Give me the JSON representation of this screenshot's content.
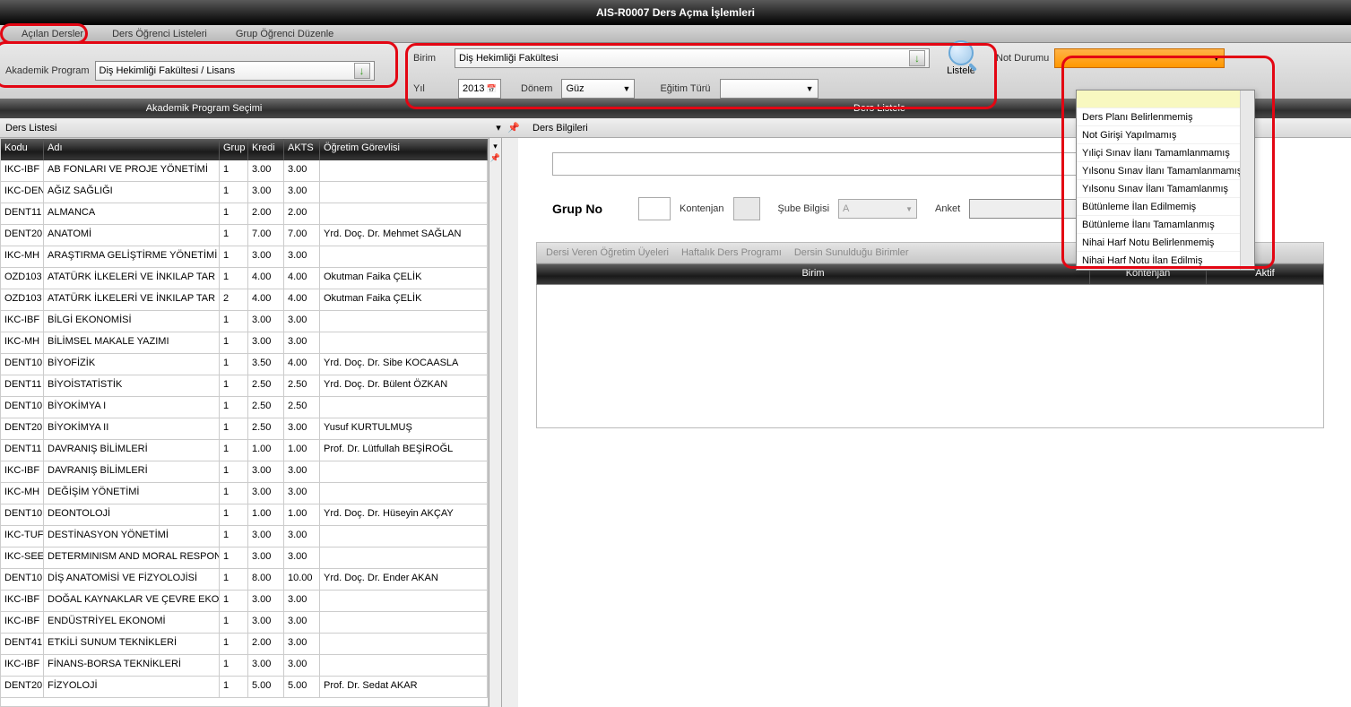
{
  "window": {
    "title": "AIS-R0007 Ders Açma İşlemleri"
  },
  "menubar": {
    "items": [
      {
        "label": "Açılan Dersler"
      },
      {
        "label": "Ders Öğrenci Listeleri"
      },
      {
        "label": "Grup Öğrenci Düzenle"
      }
    ]
  },
  "filters": {
    "akademik_program_label": "Akademik Program",
    "akademik_program_value": "Diş Hekimliği Fakültesi / Lisans",
    "birim_label": "Birim",
    "birim_value": "Diş Hekimliği Fakültesi",
    "yil_label": "Yıl",
    "yil_value": "2013",
    "donem_label": "Dönem",
    "donem_value": "Güz",
    "egitim_turu_label": "Eğitim Türü",
    "egitim_turu_value": "",
    "listele_label": "Listele",
    "not_durumu_label": "Not Durumu"
  },
  "section_headers": {
    "left": "Akademik Program Seçimi",
    "right": "Ders Listele"
  },
  "sub_headers": {
    "left": "Ders Listesi",
    "right": "Ders Bilgileri"
  },
  "grid": {
    "headers": {
      "kodu": "Kodu",
      "adi": "Adı",
      "grup": "Grup",
      "kredi": "Kredi",
      "akts": "AKTS",
      "ogretim": "Öğretim Görevlisi"
    },
    "rows": [
      {
        "kodu": "IKC-IBF",
        "adi": "AB FONLARI VE PROJE YÖNETİMİ",
        "grup": "1",
        "kredi": "3.00",
        "akts": "3.00",
        "ogr": ""
      },
      {
        "kodu": "IKC-DEN",
        "adi": "AĞIZ SAĞLIĞI",
        "grup": "1",
        "kredi": "3.00",
        "akts": "3.00",
        "ogr": ""
      },
      {
        "kodu": "DENT11",
        "adi": "ALMANCA",
        "grup": "1",
        "kredi": "2.00",
        "akts": "2.00",
        "ogr": ""
      },
      {
        "kodu": "DENT20",
        "adi": "ANATOMİ",
        "grup": "1",
        "kredi": "7.00",
        "akts": "7.00",
        "ogr": "Yrd. Doç. Dr. Mehmet SAĞLAN"
      },
      {
        "kodu": "IKC-MH",
        "adi": "ARAŞTIRMA GELİŞTİRME YÖNETİMİ",
        "grup": "1",
        "kredi": "3.00",
        "akts": "3.00",
        "ogr": ""
      },
      {
        "kodu": "OZD103",
        "adi": "ATATÜRK İLKELERİ VE İNKILAP TAR",
        "grup": "1",
        "kredi": "4.00",
        "akts": "4.00",
        "ogr": "Okutman Faika ÇELİK"
      },
      {
        "kodu": "OZD103",
        "adi": "ATATÜRK İLKELERİ VE İNKILAP TAR",
        "grup": "2",
        "kredi": "4.00",
        "akts": "4.00",
        "ogr": "Okutman Faika ÇELİK"
      },
      {
        "kodu": "IKC-IBF",
        "adi": "BİLGİ EKONOMİSİ",
        "grup": "1",
        "kredi": "3.00",
        "akts": "3.00",
        "ogr": ""
      },
      {
        "kodu": "IKC-MH",
        "adi": "BİLİMSEL MAKALE YAZIMI",
        "grup": "1",
        "kredi": "3.00",
        "akts": "3.00",
        "ogr": ""
      },
      {
        "kodu": "DENT10",
        "adi": "BİYOFİZİK",
        "grup": "1",
        "kredi": "3.50",
        "akts": "4.00",
        "ogr": "Yrd. Doç. Dr. Sibe KOCAASLA"
      },
      {
        "kodu": "DENT11",
        "adi": "BİYOİSTATİSTİK",
        "grup": "1",
        "kredi": "2.50",
        "akts": "2.50",
        "ogr": "Yrd. Doç. Dr. Bülent ÖZKAN"
      },
      {
        "kodu": "DENT10",
        "adi": "BİYOKİMYA I",
        "grup": "1",
        "kredi": "2.50",
        "akts": "2.50",
        "ogr": ""
      },
      {
        "kodu": "DENT20",
        "adi": "BİYOKİMYA II",
        "grup": "1",
        "kredi": "2.50",
        "akts": "3.00",
        "ogr": "Yusuf KURTULMUŞ"
      },
      {
        "kodu": "DENT11",
        "adi": "DAVRANIŞ BİLİMLERİ",
        "grup": "1",
        "kredi": "1.00",
        "akts": "1.00",
        "ogr": "Prof. Dr. Lütfullah BEŞİROĞL"
      },
      {
        "kodu": "IKC-IBF",
        "adi": "DAVRANIŞ BİLİMLERİ",
        "grup": "1",
        "kredi": "3.00",
        "akts": "3.00",
        "ogr": ""
      },
      {
        "kodu": "IKC-MH",
        "adi": "DEĞİŞİM YÖNETİMİ",
        "grup": "1",
        "kredi": "3.00",
        "akts": "3.00",
        "ogr": ""
      },
      {
        "kodu": "DENT10",
        "adi": "DEONTOLOJİ",
        "grup": "1",
        "kredi": "1.00",
        "akts": "1.00",
        "ogr": "Yrd. Doç. Dr. Hüseyin AKÇAY"
      },
      {
        "kodu": "IKC-TUF",
        "adi": "DESTİNASYON YÖNETİMİ",
        "grup": "1",
        "kredi": "3.00",
        "akts": "3.00",
        "ogr": ""
      },
      {
        "kodu": "IKC-SEE",
        "adi": "DETERMINISM AND MORAL RESPON",
        "grup": "1",
        "kredi": "3.00",
        "akts": "3.00",
        "ogr": ""
      },
      {
        "kodu": "DENT10",
        "adi": "DİŞ ANATOMİSİ VE FİZYOLOJİSİ",
        "grup": "1",
        "kredi": "8.00",
        "akts": "10.00",
        "ogr": "Yrd. Doç. Dr. Ender AKAN"
      },
      {
        "kodu": "IKC-IBF",
        "adi": "DOĞAL KAYNAKLAR VE ÇEVRE EKO",
        "grup": "1",
        "kredi": "3.00",
        "akts": "3.00",
        "ogr": ""
      },
      {
        "kodu": "IKC-IBF",
        "adi": "ENDÜSTRİYEL EKONOMİ",
        "grup": "1",
        "kredi": "3.00",
        "akts": "3.00",
        "ogr": ""
      },
      {
        "kodu": "DENT41",
        "adi": "ETKİLİ SUNUM TEKNİKLERİ",
        "grup": "1",
        "kredi": "2.00",
        "akts": "3.00",
        "ogr": ""
      },
      {
        "kodu": "IKC-IBF",
        "adi": "FİNANS-BORSA TEKNİKLERİ",
        "grup": "1",
        "kredi": "3.00",
        "akts": "3.00",
        "ogr": ""
      },
      {
        "kodu": "DENT20",
        "adi": "FİZYOLOJİ",
        "grup": "1",
        "kredi": "5.00",
        "akts": "5.00",
        "ogr": "Prof. Dr. Sedat AKAR"
      }
    ]
  },
  "detail": {
    "grup_no_label": "Grup No",
    "kontenjan_label": "Kontenjan",
    "sube_label": "Şube Bilgisi",
    "sube_value": "A",
    "anket_label": "Anket",
    "tabs": [
      {
        "label": "Dersi Veren Öğretim Üyeleri"
      },
      {
        "label": "Haftalık Ders Programı"
      },
      {
        "label": "Dersin Sunulduğu Birimler"
      }
    ],
    "grid_headers": {
      "birim": "Birim",
      "kontenjan": "Kontenjan",
      "aktif": "Aktif"
    }
  },
  "not_durumu_dropdown": [
    "",
    "Ders Planı Belirlenmemiş",
    "Not Girişi Yapılmamış",
    "Yıliçi Sınav İlanı Tamamlanmamış",
    "Yılsonu Sınav İlanı Tamamlanmamış",
    "Yılsonu Sınav İlanı Tamamlanmış",
    "Bütünleme İlan Edilmemiş",
    "Bütünleme İlanı Tamamlanmış",
    "Nihai Harf Notu Belirlenmemiş",
    "Nihai Harf Notu İlan Edilmiş"
  ]
}
